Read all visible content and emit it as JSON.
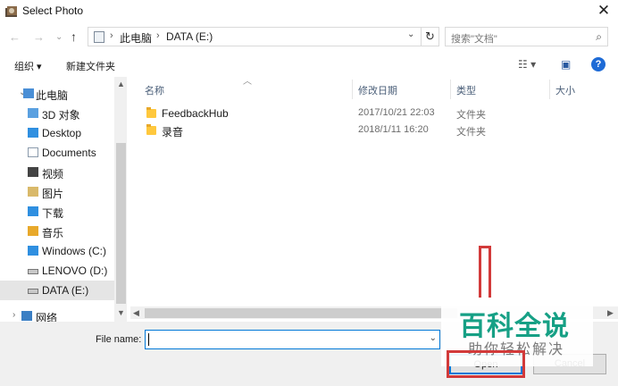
{
  "window": {
    "title": "Select Photo",
    "close_glyph": "✕",
    "icon": "app-photo-icon"
  },
  "nav": {
    "back_glyph": "←",
    "forward_glyph": "→",
    "recent_glyph": "⌄",
    "up_glyph": "↑",
    "address": {
      "icon": "this-pc-icon",
      "crumbs": [
        "此电脑",
        "DATA (E:)"
      ],
      "separator": "›",
      "dropdown_glyph": "⌄"
    },
    "refresh_glyph": "↻",
    "search": {
      "placeholder": "搜索\"文档\"",
      "icon_glyph": "⌕"
    }
  },
  "toolbar": {
    "organize_label": "组织 ▾",
    "new_folder_label": "新建文件夹",
    "view_glyph": "☷ ▾",
    "preview_glyph": "▣",
    "help_glyph": "?"
  },
  "sidebar": {
    "items": [
      {
        "label": "此电脑",
        "icon": "this-pc-icon",
        "color": "#4a8fd6"
      },
      {
        "label": "3D 对象",
        "icon": "3d-objects-icon",
        "color": "#5aa0e0"
      },
      {
        "label": "Desktop",
        "icon": "desktop-icon",
        "color": "#2f8fe0"
      },
      {
        "label": "Documents",
        "icon": "documents-icon",
        "color": "#c9d3dd"
      },
      {
        "label": "视频",
        "icon": "videos-icon",
        "color": "#444444"
      },
      {
        "label": "图片",
        "icon": "pictures-icon",
        "color": "#d9b96a"
      },
      {
        "label": "下载",
        "icon": "downloads-icon",
        "color": "#2f8fe0"
      },
      {
        "label": "音乐",
        "icon": "music-icon",
        "color": "#e8a92b"
      },
      {
        "label": "Windows (C:)",
        "icon": "drive-windows-icon",
        "color": "#2f8fe0"
      },
      {
        "label": "LENOVO (D:)",
        "icon": "drive-icon",
        "color": "#888888"
      },
      {
        "label": "DATA (E:)",
        "icon": "drive-icon",
        "color": "#888888",
        "selected": true
      },
      {
        "label": "网络",
        "icon": "network-icon",
        "color": "#3b7fc4"
      }
    ]
  },
  "columns": {
    "name": "名称",
    "modified": "修改日期",
    "type": "类型",
    "size": "大小"
  },
  "files": [
    {
      "name": "FeedbackHub",
      "modified": "2017/10/21 22:03",
      "type": "文件夹"
    },
    {
      "name": "录音",
      "modified": "2018/1/11 16:20",
      "type": "文件夹"
    }
  ],
  "footer": {
    "file_name_label": "File name:",
    "file_name_value": "",
    "open_label": "Open",
    "cancel_label": "Cancel"
  },
  "watermark": {
    "main": "百科全说",
    "sub": "助你轻松解决"
  },
  "colors": {
    "accent": "#0078d7",
    "highlight_red": "#d23a3a",
    "watermark_green": "#16a085",
    "folder_yellow": "#ffc83d"
  }
}
